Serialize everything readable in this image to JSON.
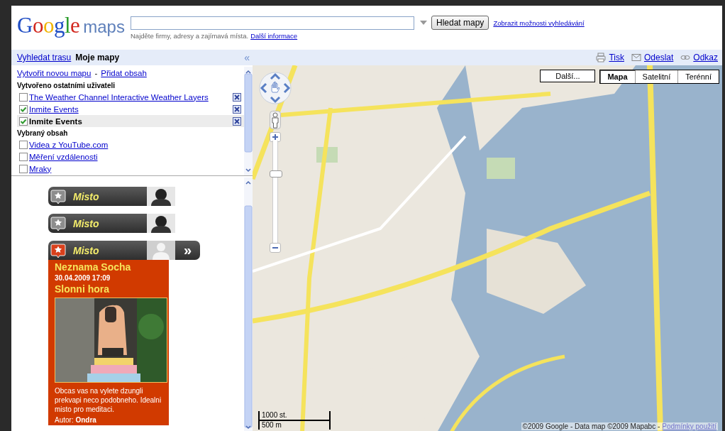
{
  "header": {
    "logo": {
      "brand": "Google",
      "product": "maps"
    },
    "search": {
      "button": "Hledat mapy",
      "options_link": "Zobrazit možnosti vyhledávání",
      "hint": "Najděte firmy, adresy a zajímavá místa.",
      "hint_link": "Další informace"
    }
  },
  "nav": {
    "tabs": [
      {
        "label": "Vyhledat trasu",
        "selected": false
      },
      {
        "label": "Moje mapy",
        "selected": true
      }
    ],
    "collapse": "«"
  },
  "map_actions": [
    {
      "kind": "print",
      "label": "Tisk"
    },
    {
      "kind": "mail",
      "label": "Odeslat"
    },
    {
      "kind": "link",
      "label": "Odkaz"
    }
  ],
  "sidebar": {
    "links": [
      "Vytvořit novou mapu",
      "Přidat obsah"
    ],
    "separator": "-",
    "groups": [
      {
        "heading": "Vytvořeno ostatními uživateli",
        "items": [
          {
            "label": "The Weather Channel Interactive Weather Layers",
            "checked": false,
            "selected": false,
            "removable": true
          },
          {
            "label": "Inmite Events",
            "checked": true,
            "selected": false,
            "removable": true
          },
          {
            "label": "Inmite Events",
            "checked": true,
            "selected": true,
            "removable": true
          }
        ]
      },
      {
        "heading": "Vybraný obsah",
        "items": [
          {
            "label": "Videa z YouTube.com",
            "checked": false,
            "selected": false,
            "removable": false
          },
          {
            "label": "Měření vzdálenosti",
            "checked": false,
            "selected": false,
            "removable": false
          },
          {
            "label": "Mraky",
            "checked": false,
            "selected": false,
            "removable": false
          }
        ]
      }
    ]
  },
  "events": [
    {
      "label": "Misto",
      "selected": false
    },
    {
      "label": "Misto",
      "selected": false
    },
    {
      "label": "Misto",
      "selected": true,
      "expand": "»",
      "detail": {
        "title": "Neznama Socha",
        "date": "30.04.2009 17:09",
        "place": "Slonni hora",
        "text": "Obcas vas na vylete dzungli prekvapi neco podobneho. Idealni misto pro meditaci.",
        "author": "Autor: **Ondra**"
      }
    }
  ],
  "map": {
    "more_button": "Další...",
    "map_types": [
      {
        "label": "Mapa",
        "selected": true
      },
      {
        "label": "Satelitní",
        "selected": false
      },
      {
        "label": "Terénní",
        "selected": false
      }
    ],
    "zoom": {
      "level": 0.7
    },
    "scale": [
      "1000 st.",
      "500 m"
    ],
    "copyright": "©2009 Google - Data map ©2009 Mapabc -",
    "terms_link": "Podmínky použití"
  }
}
